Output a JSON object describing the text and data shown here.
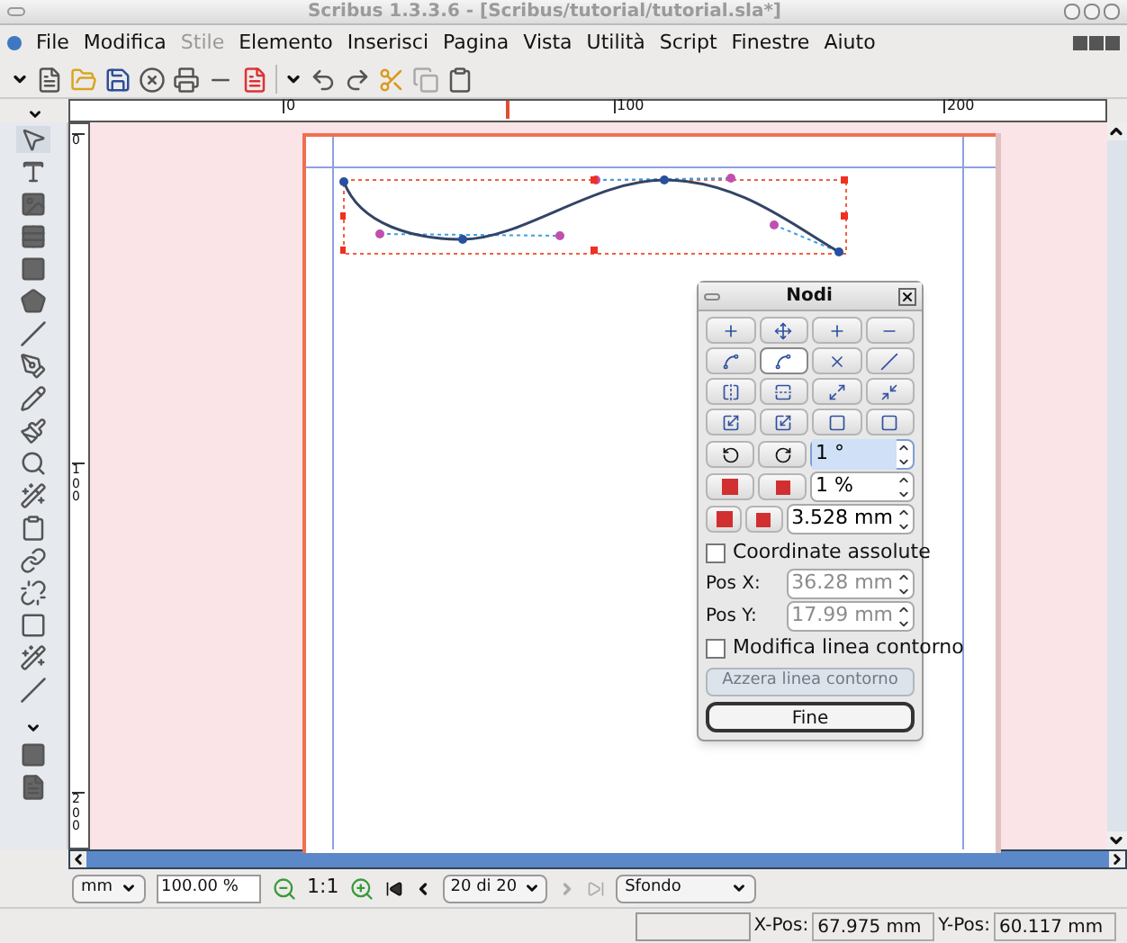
{
  "window": {
    "title": "Scribus 1.3.3.6 - [Scribus/tutorial/tutorial.sla*]"
  },
  "menu": [
    {
      "label": "File",
      "disabled": false
    },
    {
      "label": "Modifica",
      "disabled": false
    },
    {
      "label": "Stile",
      "disabled": true
    },
    {
      "label": "Elemento",
      "disabled": false
    },
    {
      "label": "Inserisci",
      "disabled": false
    },
    {
      "label": "Pagina",
      "disabled": false
    },
    {
      "label": "Vista",
      "disabled": false
    },
    {
      "label": "Utilità",
      "disabled": false
    },
    {
      "label": "Script",
      "disabled": false
    },
    {
      "label": "Finestre",
      "disabled": false
    },
    {
      "label": "Aiuto",
      "disabled": false
    }
  ],
  "rulers": {
    "horizontal": [
      "0",
      "100",
      "200"
    ],
    "vertical": [
      "0",
      "100",
      "200"
    ]
  },
  "nodes_panel": {
    "title": "Nodi",
    "tools": [
      {
        "selected": false
      },
      {
        "selected": false
      },
      {
        "selected": false
      },
      {
        "selected": false
      },
      {
        "selected": false
      },
      {
        "selected": true
      },
      {
        "selected": false
      },
      {
        "selected": false
      },
      {
        "selected": false
      },
      {
        "selected": false
      },
      {
        "selected": false
      },
      {
        "selected": false
      },
      {
        "selected": false
      },
      {
        "selected": false
      },
      {
        "selected": false
      },
      {
        "selected": false
      }
    ],
    "spin_rows": [
      {
        "value": "1 °",
        "focused": true
      },
      {
        "value": "1 %",
        "focused": false
      },
      {
        "value": "3.528 mm",
        "focused": false
      }
    ],
    "absolute": {
      "label": "Coordinate assolute",
      "checked": false
    },
    "pos": [
      {
        "label": "Pos X:",
        "value": "36.28 mm",
        "disabled": true
      },
      {
        "label": "Pos Y:",
        "value": "17.99 mm",
        "disabled": true
      }
    ],
    "contour": {
      "label": "Modifica linea contorno",
      "checked": false
    },
    "reset_button": {
      "label": "Azzera linea contorno",
      "disabled": true
    },
    "done_button": {
      "label": "Fine"
    }
  },
  "bottom_bar": {
    "unit": "mm",
    "zoom": "100.00 %",
    "ratio": "1:1",
    "page": "20 di 20",
    "layer": "Sfondo"
  },
  "status_bar": {
    "x_label": "X-Pos:",
    "x_value": "67.975 mm",
    "y_label": "Y-Pos:",
    "y_value": "60.117 mm"
  }
}
